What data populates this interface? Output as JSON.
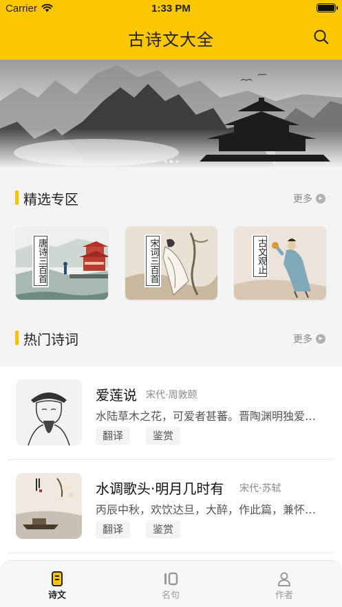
{
  "status_bar": {
    "carrier": "Carrier",
    "time": "1:33 PM"
  },
  "nav": {
    "title": "古诗文大全",
    "search_icon": "search-icon"
  },
  "banner": {
    "dot_count": 3,
    "active_dot": 1
  },
  "featured": {
    "title": "精选专区",
    "more": "更多",
    "cards": [
      {
        "label": "唐诗三百首"
      },
      {
        "label": "宋词三百首"
      },
      {
        "label": "古文观止"
      }
    ]
  },
  "hot": {
    "title": "热门诗词",
    "more": "更多",
    "items": [
      {
        "name": "爱莲说",
        "meta": "宋代·周敦颐",
        "excerpt": "水陆草木之花，可爱者甚蕃。晋陶渊明独爱菊。",
        "tags": [
          "翻译",
          "鉴赏"
        ]
      },
      {
        "name": "水调歌头·明月几时有",
        "meta": "宋代·苏轼",
        "excerpt": "丙辰中秋，欢饮达旦，大醉，作此篇，兼怀子由。",
        "tags": [
          "翻译",
          "鉴赏"
        ]
      }
    ]
  },
  "tabbar": {
    "tabs": [
      {
        "label": "诗文",
        "icon": "document-icon",
        "active": true
      },
      {
        "label": "名句",
        "icon": "quote-icon",
        "active": false
      },
      {
        "label": "作者",
        "icon": "person-icon",
        "active": false
      }
    ]
  },
  "colors": {
    "accent": "#fac700",
    "background": "#f4f4f4"
  }
}
